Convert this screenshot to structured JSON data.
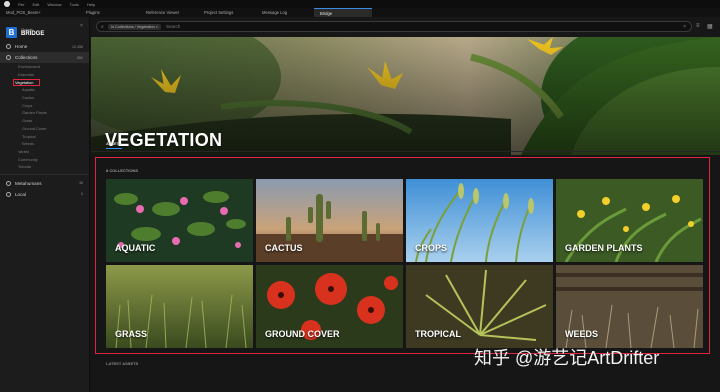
{
  "menubar": {
    "items": [
      "File",
      "Edit",
      "Window",
      "Tools",
      "Help"
    ]
  },
  "tabs": [
    {
      "label": "Mod_POS_Bexm+"
    },
    {
      "label": "Plugins"
    },
    {
      "label": "Reference Viewer"
    },
    {
      "label": "Project Settings"
    },
    {
      "label": "Message Log"
    },
    {
      "label": "Bridge"
    }
  ],
  "brand": {
    "line1": "Quixel",
    "line2": "BRIDGE",
    "close": "×"
  },
  "nav": {
    "home": {
      "label": "Home",
      "count": "12,456"
    },
    "collections": {
      "label": "Collections",
      "count": "850"
    },
    "collection_items": [
      "Environment",
      "Essential",
      "Vegetation"
    ],
    "vegetation_sub": [
      "Aquatic",
      "Cactus",
      "Crops",
      "Garden Plants",
      "Grass",
      "Ground Cover",
      "Tropical",
      "Weeds"
    ],
    "after": [
      "Varied",
      "Community",
      "Tutorial"
    ],
    "metahumans": {
      "label": "Metahumans",
      "count": "36"
    },
    "local": {
      "label": "Local",
      "count": "0"
    }
  },
  "search": {
    "chip": "In Collections / Vegetation ×",
    "placeholder": "Search",
    "clear": "×"
  },
  "hero": {
    "title": "VEGETATION"
  },
  "tabs_main": {
    "assets": "ASSETS"
  },
  "grid": {
    "count_label": "8 COLLECTIONS",
    "cards": [
      {
        "label": "AQUATIC"
      },
      {
        "label": "CACTUS"
      },
      {
        "label": "CROPS"
      },
      {
        "label": "GARDEN PLANTS"
      },
      {
        "label": "GRASS"
      },
      {
        "label": "GROUND COVER"
      },
      {
        "label": "TROPICAL"
      },
      {
        "label": "WEEDS"
      }
    ]
  },
  "latest": {
    "label": "LATEST ASSETS"
  },
  "watermark": {
    "text": "知乎 @游艺记ArtDrifter"
  },
  "colors": {
    "accent": "#2f8fff",
    "highlight": "#e0263e",
    "brand": "#1f6fd1"
  }
}
